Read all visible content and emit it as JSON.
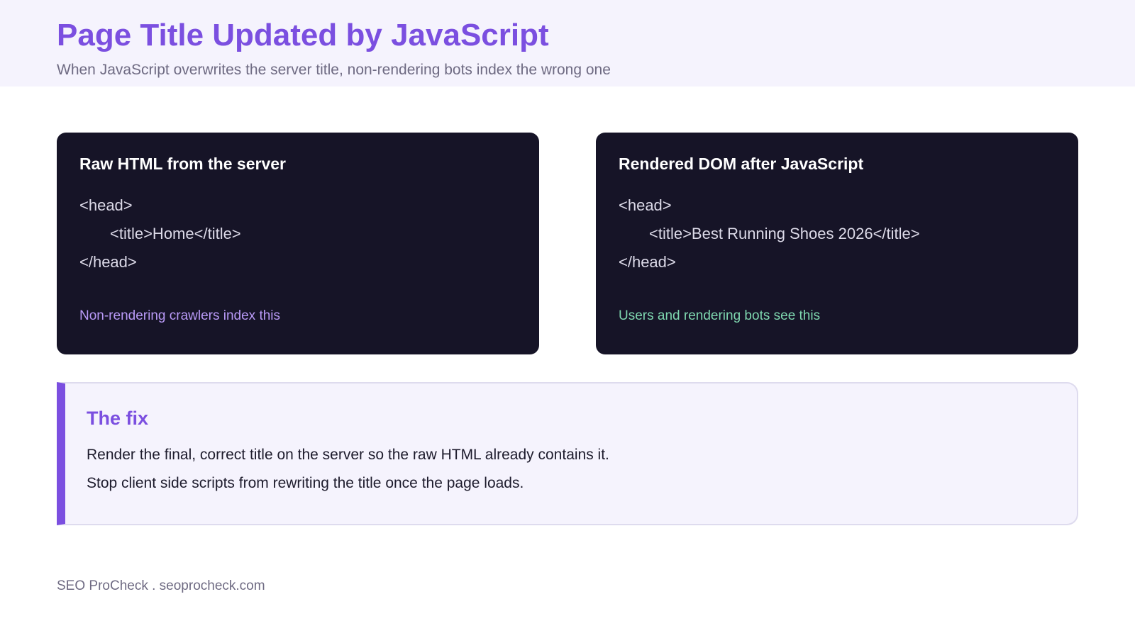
{
  "header": {
    "title": "Page Title Updated by JavaScript",
    "subtitle": "When JavaScript overwrites the server title, non-rendering bots index the wrong one"
  },
  "panels": [
    {
      "title": "Raw HTML from the server",
      "code": [
        "<head>",
        "<title>Home</title>",
        "</head>"
      ],
      "note": "Non-rendering crawlers index this",
      "note_color": "#b99af7"
    },
    {
      "title": "Rendered DOM after JavaScript",
      "code": [
        "<head>",
        "<title>Best Running Shoes 2026</title>",
        "</head>"
      ],
      "note": "Users and rendering bots see this",
      "note_color": "#7fd8b0"
    }
  ],
  "fix": {
    "title": "The fix",
    "lines": [
      "Render the final, correct title on the server so the raw HTML already contains it.",
      "Stop client side scripts from rewriting the title once the page loads."
    ]
  },
  "footer": "SEO ProCheck . seoprocheck.com",
  "colors": {
    "accent": "#7b4fe0",
    "header_bg": "#f5f3fd",
    "panel_bg": "#161427"
  }
}
